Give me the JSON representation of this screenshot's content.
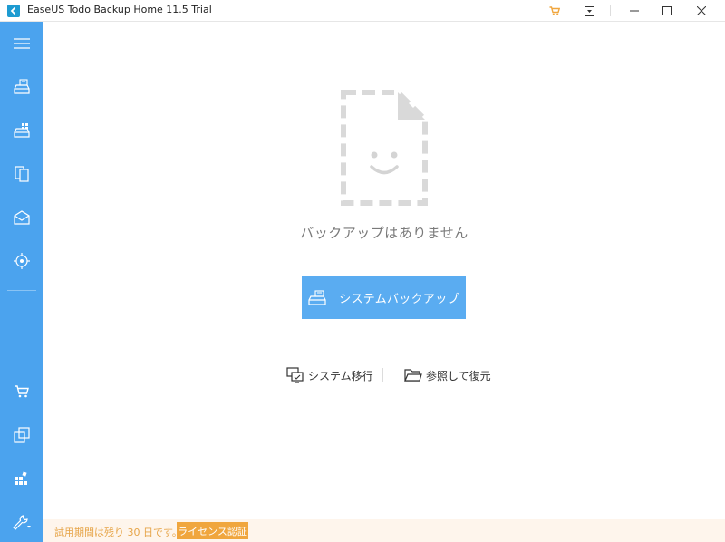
{
  "window": {
    "title": "EaseUS Todo Backup Home 11.5 Trial",
    "icons": {
      "app": "app-logo-icon",
      "cart": "cart-icon",
      "menu": "dropdown-menu-icon",
      "minimize": "minimize-icon",
      "maximize": "maximize-icon",
      "close": "close-icon"
    }
  },
  "sidebar": {
    "items": [
      {
        "icon": "hamburger-menu-icon"
      },
      {
        "icon": "system-backup-icon"
      },
      {
        "icon": "disk-backup-icon"
      },
      {
        "icon": "file-backup-icon"
      },
      {
        "icon": "mail-backup-icon"
      },
      {
        "icon": "smart-backup-icon"
      },
      {
        "icon": "cart-icon"
      },
      {
        "icon": "clone-icon"
      },
      {
        "icon": "tools-grid-icon"
      },
      {
        "icon": "wrench-settings-icon"
      }
    ]
  },
  "main": {
    "empty_message": "バックアップはありません",
    "primary_button": {
      "label": "システムバックアップ",
      "icon": "system-backup-icon"
    },
    "links": [
      {
        "label": "システム移行",
        "icon": "system-transfer-icon"
      },
      {
        "label": "参照して復元",
        "icon": "folder-icon"
      }
    ]
  },
  "footer": {
    "trial_text": "試用期間は残り 30 日です。",
    "license_button": "ライセンス認証"
  },
  "colors": {
    "sidebar": "#4ba3ee",
    "primary_button": "#5aacf1",
    "footer_bg": "#fef5ec",
    "footer_text": "#e6a447",
    "license_button": "#f0a63e",
    "cart_icon": "#f0a63e"
  }
}
